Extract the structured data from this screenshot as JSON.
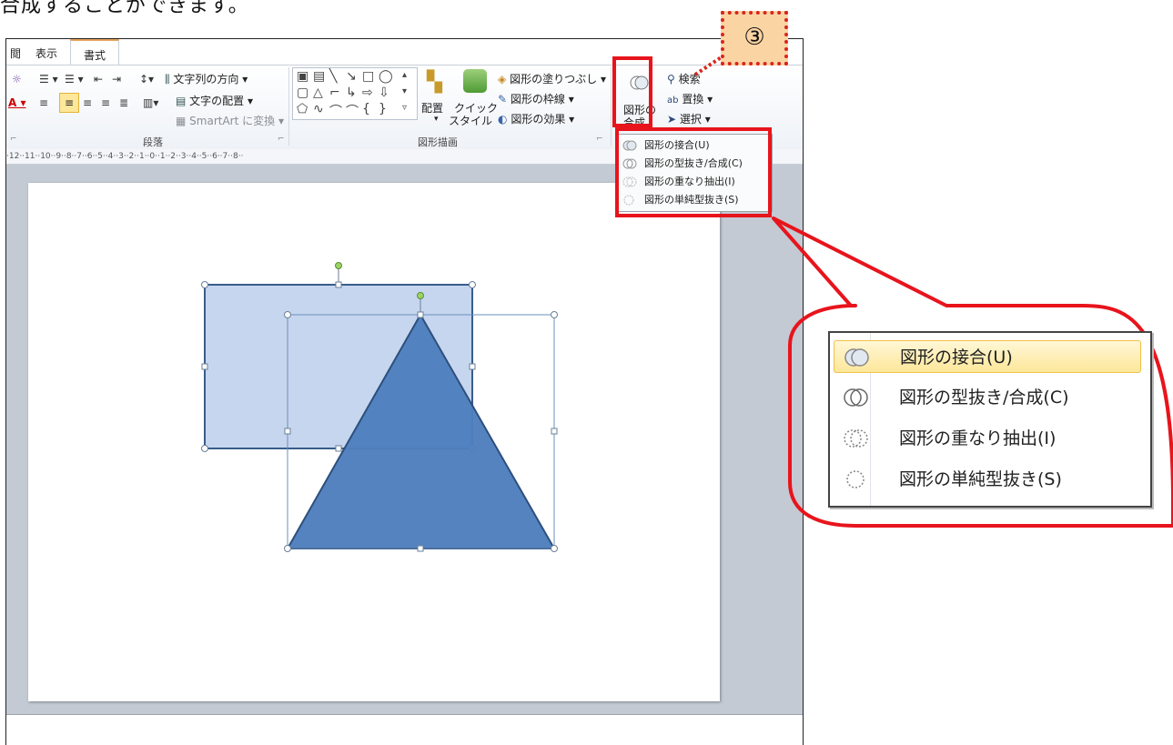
{
  "intro_text": "合成することができます。",
  "tabs": [
    {
      "label": "閲"
    },
    {
      "label": "表示"
    },
    {
      "label": "書式"
    }
  ],
  "ribbon": {
    "paragraph": {
      "group_label": "段落",
      "text_direction": "文字列の方向",
      "text_align": "文字の配置",
      "smartart": "SmartArt に変換"
    },
    "drawing": {
      "group_label": "図形描画",
      "arrange": "配置",
      "quick_style_1": "クイック",
      "quick_style_2": "スタイル",
      "shape_fill": "図形の塗りつぶし",
      "shape_outline": "図形の枠線",
      "shape_effects": "図形の効果"
    },
    "merge": {
      "label_1": "図形の",
      "label_2": "合成"
    },
    "editing": {
      "find": "検索",
      "replace": "置換",
      "select": "選択"
    },
    "icons": {
      "merge": "merge-shapes-icon",
      "find": "binoculars-icon",
      "replace": "replace-icon",
      "select": "cursor-icon"
    }
  },
  "ruler_text": "·12··11··10··9··8··7··6··5··4··3··2··1··0··1··2··3··4··5··6··7··8··",
  "menu": {
    "items": [
      {
        "label": "図形の接合(U)",
        "icon": "union-icon"
      },
      {
        "label": "図形の型抜き/合成(C)",
        "icon": "combine-icon"
      },
      {
        "label": "図形の重なり抽出(I)",
        "icon": "intersect-icon"
      },
      {
        "label": "図形の単純型抜き(S)",
        "icon": "subtract-icon"
      }
    ]
  },
  "callout": {
    "step": "③"
  },
  "colors": {
    "highlight_red": "#e8141c",
    "rect_fill": "#c6d6ee",
    "rect_stroke": "#385d8a",
    "triangle_fill": "#4f7fbe",
    "triangle_stroke": "#2d4f7c",
    "badge_fill": "#fbd4a4"
  }
}
